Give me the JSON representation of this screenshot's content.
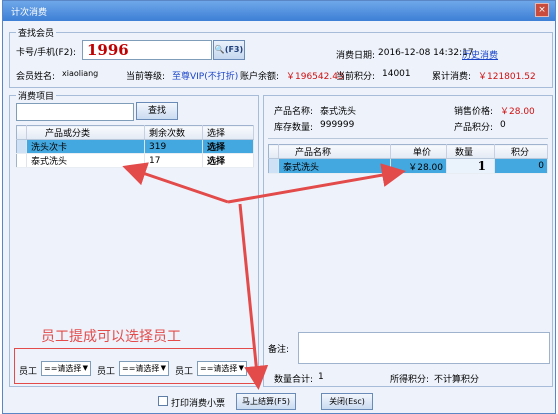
{
  "window": {
    "title": "计次消费",
    "close_glyph": "×"
  },
  "member": {
    "group_title": "查找会员",
    "card_label": "卡号/手机(F2):",
    "card_value": "1996",
    "search_btn": "(F3)",
    "date_label": "消费日期:",
    "date_value": "2016-12-08 14:32:17",
    "history_link": "历史消费",
    "name_label": "会员姓名:",
    "name_value": "xiaoliang",
    "level_label": "当前等级:",
    "level_value": "至尊VIP(不打折)",
    "balance_label": "账户余额:",
    "balance_value": "￥196542.43",
    "points_label": "当前积分:",
    "points_value": "14001",
    "total_label": "累计消费:",
    "total_value": "￥121801.52"
  },
  "items": {
    "group_title": "消费项目",
    "search_placeholder": "",
    "search_btn": "查找",
    "columns": [
      "产品或分类",
      "剩余次数",
      "选择"
    ],
    "rows": [
      {
        "name": "洗头次卡",
        "count": "319",
        "choose": "选择"
      },
      {
        "name": "泰式洗头",
        "count": "17",
        "choose": "选择"
      }
    ]
  },
  "staff": {
    "note": "员工提成可以选择员工",
    "label": "员工",
    "select_value": "==请选择"
  },
  "product": {
    "name_label": "产品名称:",
    "name_value": "泰式洗头",
    "price_label": "销售价格:",
    "price_value": "￥28.00",
    "stock_label": "库存数量:",
    "stock_value": "999999",
    "points_label": "产品积分:",
    "points_value": "0",
    "columns": [
      "产品名称",
      "单价",
      "数量",
      "积分"
    ],
    "rows": [
      {
        "name": "泰式洗头",
        "price": "￥28.00",
        "qty": "1",
        "points": "0"
      }
    ],
    "remark_label": "备注:",
    "qty_total_label": "数量合计:",
    "qty_total_value": "1",
    "earned_label": "所得积分:",
    "earned_value": "不计算积分"
  },
  "footer": {
    "print_label": "打印消费小票",
    "pay_btn": "马上结算(F5)",
    "close_btn": "关闭(Esc)"
  },
  "colors": {
    "accent_red": "#d01010",
    "annotation_red": "#e34a4a",
    "selection_blue": "#44a8e0"
  }
}
